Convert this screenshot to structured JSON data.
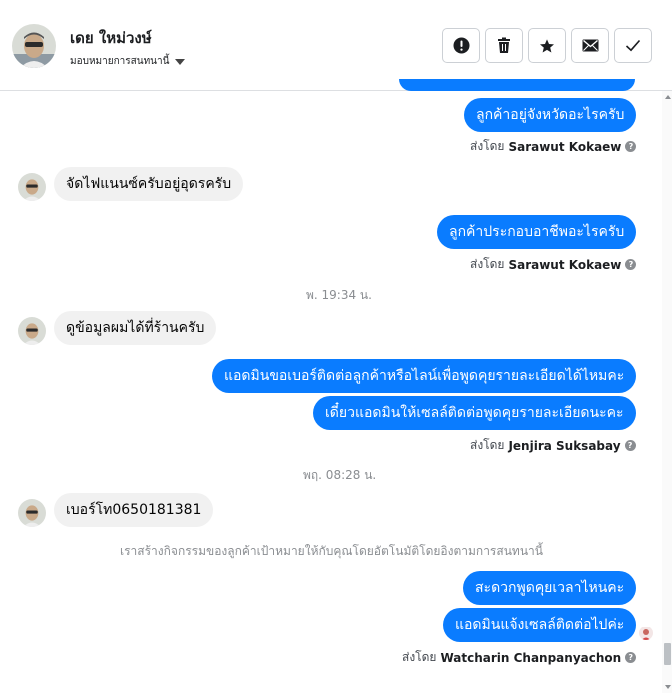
{
  "header": {
    "contact_name": "เดย ใหม่วงษ์",
    "assign_label": "มอบหมายการสนทนานี้",
    "actions": [
      {
        "name": "mark-spam-button",
        "icon": "exclamation-circle-icon"
      },
      {
        "name": "delete-button",
        "icon": "trash-icon"
      },
      {
        "name": "star-button",
        "icon": "star-icon"
      },
      {
        "name": "mark-unread-button",
        "icon": "envelope-icon"
      },
      {
        "name": "mark-done-button",
        "icon": "checkmark-icon"
      }
    ]
  },
  "conversation": {
    "messages": [
      {
        "direction": "out",
        "text": "ลูกค้าอยู่จังหวัดอะไรครับ"
      },
      {
        "direction": "in",
        "text": "จัดไฟแนนซ์ครับอยู่อุดรครับ"
      },
      {
        "direction": "out",
        "text": "ลูกค้าประกอบอาชีพอะไรครับ"
      },
      {
        "direction": "in",
        "text": "ดูข้อมูลผมได้ที่ร้านครับ"
      },
      {
        "direction": "out",
        "text": "แอดมินขอเบอร์ติดต่อลูกค้าหรือไลน์เพื่อพูดคุยรายละเอียดได้ไหมคะ"
      },
      {
        "direction": "out",
        "text": "เดี๋ยวแอดมินให้เซลล์ติดต่อพูดคุยรายละเอียดนะคะ"
      },
      {
        "direction": "in",
        "text": "เบอร์โท0650181381"
      },
      {
        "direction": "out",
        "text": "สะดวกพูดคุยเวลาไหนคะ"
      },
      {
        "direction": "out",
        "text": "แอดมินแจ้งเซลล์ติดต่อไปค่ะ"
      }
    ],
    "sent_by_prefix": "ส่งโดย",
    "senders": [
      "Sarawut Kokaew",
      "Sarawut Kokaew",
      "Jenjira Suksabay",
      "Watcharin Chanpanyachon"
    ],
    "timestamps": [
      "พ. 19:34 น.",
      "พฤ. 08:28 น."
    ],
    "notice": "เราสร้างกิจกรรมของลูกค้าเป้าหมายให้กับคุณโดยอัตโนมัติโดยอิงตามการสนทนานี้",
    "help_glyph": "?"
  },
  "colors": {
    "outgoing_bubble": "#0a7cff",
    "incoming_bubble": "#f1f1f1",
    "timestamp_text": "#8a8d91"
  }
}
